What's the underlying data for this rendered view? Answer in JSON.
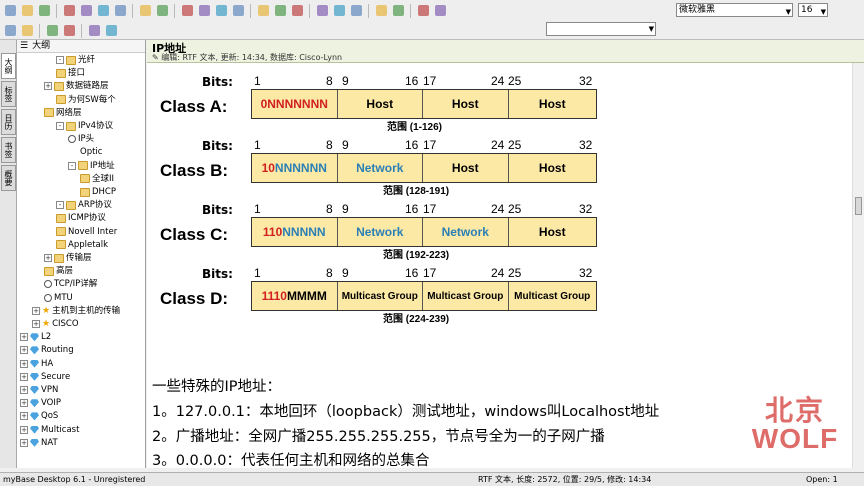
{
  "toolbar": {
    "font_name": "微软雅黑",
    "font_size": "16",
    "icons_row1": [
      "new-icon",
      "open-icon",
      "save-icon",
      "print-icon",
      "cut-icon",
      "copy-icon",
      "paste-icon",
      "back-icon",
      "forward-icon",
      "bold-icon",
      "italic-icon",
      "underline-icon",
      "strike-icon",
      "align-left-icon",
      "align-center-icon",
      "align-right-icon",
      "pen-icon",
      "undo-icon",
      "redo-icon",
      "scissors-icon",
      "delete-icon",
      "layout-icon",
      "color-icon"
    ],
    "icons_row2": [
      "nav-back-icon",
      "nav-forward-icon",
      "refresh-icon",
      "search-icon",
      "find-icon",
      "settings-icon"
    ]
  },
  "tabs": [
    "大纲",
    "标签",
    "日历",
    "书签",
    "概要"
  ],
  "tree": {
    "header": "大纲",
    "nodes": [
      {
        "label": "光纤",
        "indent": 3,
        "icon": "folder"
      },
      {
        "label": "接口",
        "indent": 3,
        "icon": "folder"
      },
      {
        "label": "数据链路层",
        "indent": 2,
        "icon": "folder"
      },
      {
        "label": "为何SW每个",
        "indent": 3,
        "icon": "folder"
      },
      {
        "label": "网络层",
        "indent": 2,
        "icon": "folder"
      },
      {
        "label": "IPv4协议",
        "indent": 3,
        "icon": "folder"
      },
      {
        "label": "IP头",
        "indent": 4,
        "icon": "pin"
      },
      {
        "label": "Optic",
        "indent": 5,
        "icon": "none"
      },
      {
        "label": "IP地址",
        "indent": 4,
        "icon": "folder"
      },
      {
        "label": "全球II",
        "indent": 5,
        "icon": "folder"
      },
      {
        "label": "DHCP",
        "indent": 5,
        "icon": "folder"
      },
      {
        "label": "ARP协议",
        "indent": 3,
        "icon": "folder"
      },
      {
        "label": "ICMP协议",
        "indent": 3,
        "icon": "folder"
      },
      {
        "label": "Novell Inter",
        "indent": 3,
        "icon": "folder"
      },
      {
        "label": "Appletalk",
        "indent": 3,
        "icon": "folder"
      },
      {
        "label": "传输层",
        "indent": 2,
        "icon": "folder"
      },
      {
        "label": "高层",
        "indent": 2,
        "icon": "folder"
      },
      {
        "label": "TCP/IP详解",
        "indent": 2,
        "icon": "pin"
      },
      {
        "label": "MTU",
        "indent": 2,
        "icon": "pin"
      },
      {
        "label": "主机到主机的传输",
        "indent": 1,
        "icon": "star"
      },
      {
        "label": "CISCO",
        "indent": 1,
        "icon": "star"
      },
      {
        "label": "L2",
        "indent": 0,
        "icon": "gem"
      },
      {
        "label": "Routing",
        "indent": 0,
        "icon": "gem"
      },
      {
        "label": "HA",
        "indent": 0,
        "icon": "gem"
      },
      {
        "label": "Secure",
        "indent": 0,
        "icon": "gem"
      },
      {
        "label": "VPN",
        "indent": 0,
        "icon": "gem"
      },
      {
        "label": "VOIP",
        "indent": 0,
        "icon": "gem"
      },
      {
        "label": "QoS",
        "indent": 0,
        "icon": "gem"
      },
      {
        "label": "Multicast",
        "indent": 0,
        "icon": "gem"
      },
      {
        "label": "NAT",
        "indent": 0,
        "icon": "gem"
      }
    ]
  },
  "doc": {
    "title": "IP地址",
    "meta": "编辑: RTF 文本, 更新: 14:34, 数据库: Cisco-Lynn",
    "bits_label": "Bits:",
    "bit_numbers": [
      "1",
      "8",
      "9",
      "16",
      "17",
      "24",
      "25",
      "32"
    ],
    "classes": [
      {
        "name": "Class A:",
        "prefix": "0",
        "rest": "NNNNNNN",
        "segs": [
          "Host",
          "Host",
          "Host"
        ],
        "range": "范围 (1-126)"
      },
      {
        "name": "Class B:",
        "prefix": "10",
        "rest": "NNNNNN",
        "segs": [
          "Network",
          "Host",
          "Host"
        ],
        "range": "范围 (128-191)"
      },
      {
        "name": "Class C:",
        "prefix": "110",
        "rest": "NNNNN",
        "segs": [
          "Network",
          "Network",
          "Host"
        ],
        "range": "范围 (192-223)"
      },
      {
        "name": "Class D:",
        "prefix": "1110",
        "rest": "MMMM",
        "segs": [
          "Multicast Group",
          "Multicast Group",
          "Multicast Group"
        ],
        "range": "范围 (224-239)"
      }
    ],
    "paragraphs": [
      "一些特殊的IP地址：",
      "1。127.0.0.1：本地回环（loopback）测试地址，windows叫Localhost地址",
      "2。广播地址：全网广播255.255.255.255，节点号全为一的子网广播",
      "3。0.0.0.0：代表任何主机和网络的总集合"
    ]
  },
  "watermark": {
    "line1": "北京",
    "line2": "WOLF"
  },
  "status": {
    "app": "myBase Desktop 6.1 - Unregistered",
    "info": "RTF 文本, 长度: 2572, 位置: 29/5, 修改: 14:34",
    "open": "Open: 1"
  },
  "colors": {
    "accent_red": "#d02020",
    "accent_blue": "#2a7fb5",
    "bar_fill": "#fde9a6",
    "watermark": "#d9534f"
  }
}
